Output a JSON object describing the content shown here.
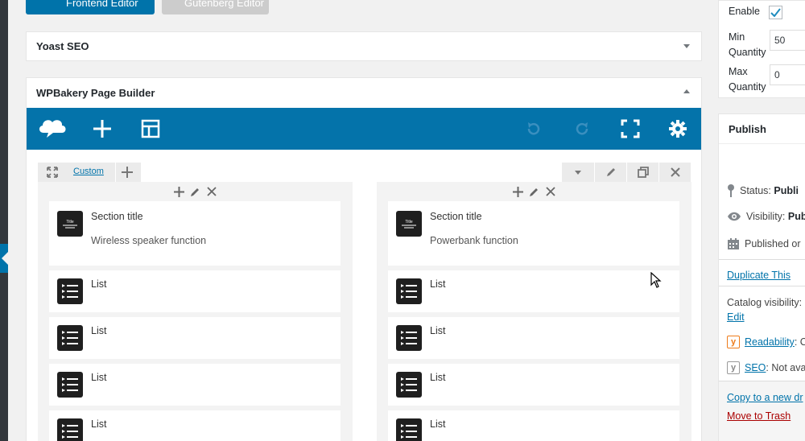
{
  "editor_buttons": {
    "frontend": "Frontend Editor",
    "gutenberg": "Gutenberg Editor"
  },
  "yoast": {
    "title": "Yoast SEO"
  },
  "wpbakery": {
    "title": "WPBakery Page Builder",
    "row_layout_label": "Custom",
    "columns": [
      {
        "elements": [
          {
            "name": "Section title",
            "subtitle": "Wireless speaker function",
            "icon": "title-icon"
          },
          {
            "name": "List",
            "icon": "list-icon"
          },
          {
            "name": "List",
            "icon": "list-icon"
          },
          {
            "name": "List",
            "icon": "list-icon"
          },
          {
            "name": "List",
            "icon": "list-icon"
          }
        ]
      },
      {
        "elements": [
          {
            "name": "Section title",
            "subtitle": "Powerbank function",
            "icon": "title-icon"
          },
          {
            "name": "List",
            "icon": "list-icon"
          },
          {
            "name": "List",
            "icon": "list-icon"
          },
          {
            "name": "List",
            "icon": "list-icon"
          },
          {
            "name": "List",
            "icon": "list-icon"
          }
        ]
      }
    ],
    "title_icon_text": "Title"
  },
  "quantity": {
    "enable_label": "Enable",
    "enabled": true,
    "min_label_1": "Min",
    "min_label_2": "Quantity",
    "min_value": "50",
    "max_label_1": "Max",
    "max_label_2": "Quantity",
    "max_value": "0"
  },
  "publish": {
    "title": "Publish",
    "status_label": "Status:",
    "status_value": "Publi",
    "visibility_label": "Visibility:",
    "visibility_value": "Pub",
    "published_on": "Published or",
    "duplicate": "Duplicate This",
    "catalog_label": "Catalog visibility:",
    "catalog_edit": "Edit",
    "readability_label": "Readability",
    "readability_value": ": C",
    "seo_label": "SEO",
    "seo_value": ": Not ava",
    "copy_draft": "Copy to a new dr",
    "move_trash": "Move to Trash"
  },
  "colors": {
    "accent": "#0473aa",
    "link": "#0073aa",
    "trash": "#a00"
  }
}
